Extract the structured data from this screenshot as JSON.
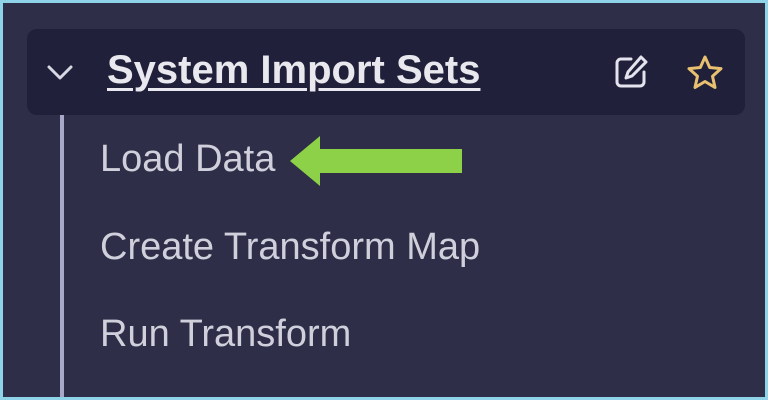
{
  "section": {
    "title": "System Import Sets",
    "chevron_icon": "chevron-down-icon",
    "edit_icon": "edit-icon",
    "favorite_icon": "star-icon"
  },
  "items": [
    {
      "label": "Load Data"
    },
    {
      "label": "Create Transform Map"
    },
    {
      "label": "Run Transform"
    },
    {
      "label": ""
    }
  ],
  "annotation": {
    "arrow_color": "#8cd147",
    "icon": "arrow-left-icon"
  },
  "colors": {
    "background": "#2e2e48",
    "header_background": "#20203a",
    "title_text": "#e8e8ee",
    "item_text": "#d0d0dc",
    "star": "#e8c070",
    "border": "#8fd3e8"
  }
}
